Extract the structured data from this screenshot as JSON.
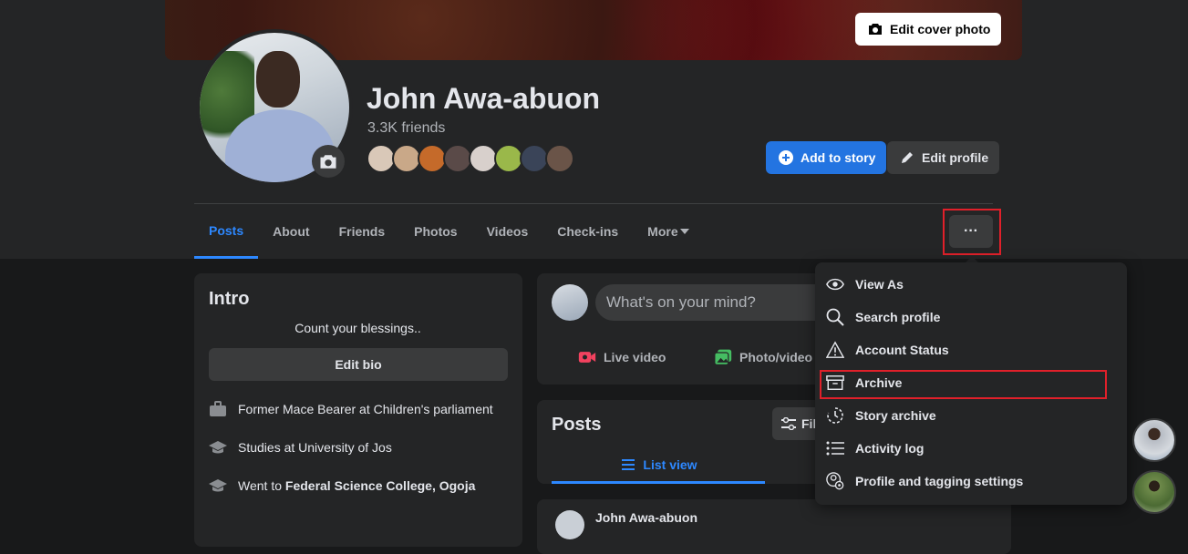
{
  "profile": {
    "name": "John Awa-abuon",
    "friends_count": "3.3K friends",
    "edit_cover_label": "Edit cover photo",
    "add_story_label": "Add to story",
    "edit_profile_label": "Edit profile",
    "more_options_label": "···"
  },
  "tabs": [
    {
      "label": "Posts",
      "active": true
    },
    {
      "label": "About"
    },
    {
      "label": "Friends"
    },
    {
      "label": "Photos"
    },
    {
      "label": "Videos"
    },
    {
      "label": "Check-ins"
    },
    {
      "label": "More"
    }
  ],
  "intro": {
    "title": "Intro",
    "bio": "Count your blessings..",
    "edit_bio_label": "Edit bio",
    "items": [
      {
        "icon": "briefcase-icon",
        "text": "Former Mace Bearer at Children's parliament"
      },
      {
        "icon": "graduation-cap-icon",
        "text": "Studies at University of Jos"
      },
      {
        "icon": "graduation-cap-icon",
        "prefix": "Went to ",
        "bold": "Federal Science College, Ogoja"
      }
    ]
  },
  "composer": {
    "placeholder": "What's on your mind?",
    "live_video_label": "Live video",
    "photo_video_label": "Photo/video"
  },
  "posts": {
    "title": "Posts",
    "filters_label": "Filters",
    "list_view_label": "List view",
    "first_post_author": "John Awa-abuon"
  },
  "menu": {
    "items": [
      {
        "icon": "eye-icon",
        "label": "View As"
      },
      {
        "icon": "search-icon",
        "label": "Search profile"
      },
      {
        "icon": "warning-icon",
        "label": "Account Status"
      },
      {
        "icon": "archive-icon",
        "label": "Archive",
        "highlighted": true
      },
      {
        "icon": "story-archive-icon",
        "label": "Story archive"
      },
      {
        "icon": "list-icon",
        "label": "Activity log"
      },
      {
        "icon": "profile-settings-icon",
        "label": "Profile and tagging settings"
      }
    ]
  },
  "colors": {
    "accent": "#2d88ff",
    "primary_button": "#2374e1",
    "highlight_border": "#e0202a",
    "surface": "#242526",
    "background": "#18191a"
  }
}
